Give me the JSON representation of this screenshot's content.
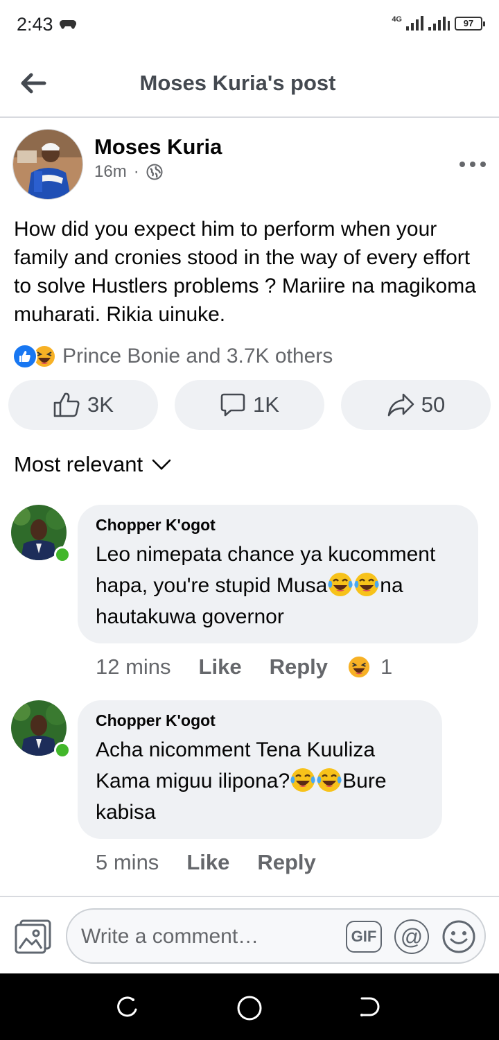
{
  "status_bar": {
    "time": "2:43",
    "network": "4G",
    "battery": "97"
  },
  "header": {
    "title": "Moses Kuria's post"
  },
  "post": {
    "author": "Moses Kuria",
    "time": "16m",
    "separator": "·",
    "text": "How did you expect him to perform  when your family and cronies stood in the way of every effort to solve Hustlers problems ? Mariire na magikoma muharati. Rikia uinuke.",
    "reactions_summary": "Prince Bonie and 3.7K others",
    "like_count": "3K",
    "comment_count": "1K",
    "share_count": "50"
  },
  "sort": {
    "label": "Most relevant"
  },
  "comments": [
    {
      "author": "Chopper K'ogot",
      "text_before": "Leo nimepata chance ya kucomment hapa, you're stupid Musa",
      "text_after": "na hautakuwa governor",
      "time": "12 mins",
      "like_label": "Like",
      "reply_label": "Reply",
      "reaction_count": "1"
    },
    {
      "author": "Chopper K'ogot",
      "text_before": "Acha nicomment Tena Kuuliza Kama miguu ilipona?",
      "text_after": "Bure kabisa",
      "time": "5 mins",
      "like_label": "Like",
      "reply_label": "Reply"
    }
  ],
  "composer": {
    "placeholder": "Write a comment…",
    "gif_label": "GIF",
    "mention_label": "@"
  },
  "colors": {
    "accent": "#1877f2",
    "online": "#42b72a",
    "bubble": "#eff1f4",
    "secondary_text": "#65676b"
  },
  "icons": [
    "back-arrow-icon",
    "globe-icon",
    "more-icon",
    "like-icon",
    "comment-icon",
    "share-icon",
    "chevron-down-icon",
    "photo-icon",
    "emoji-icon"
  ]
}
